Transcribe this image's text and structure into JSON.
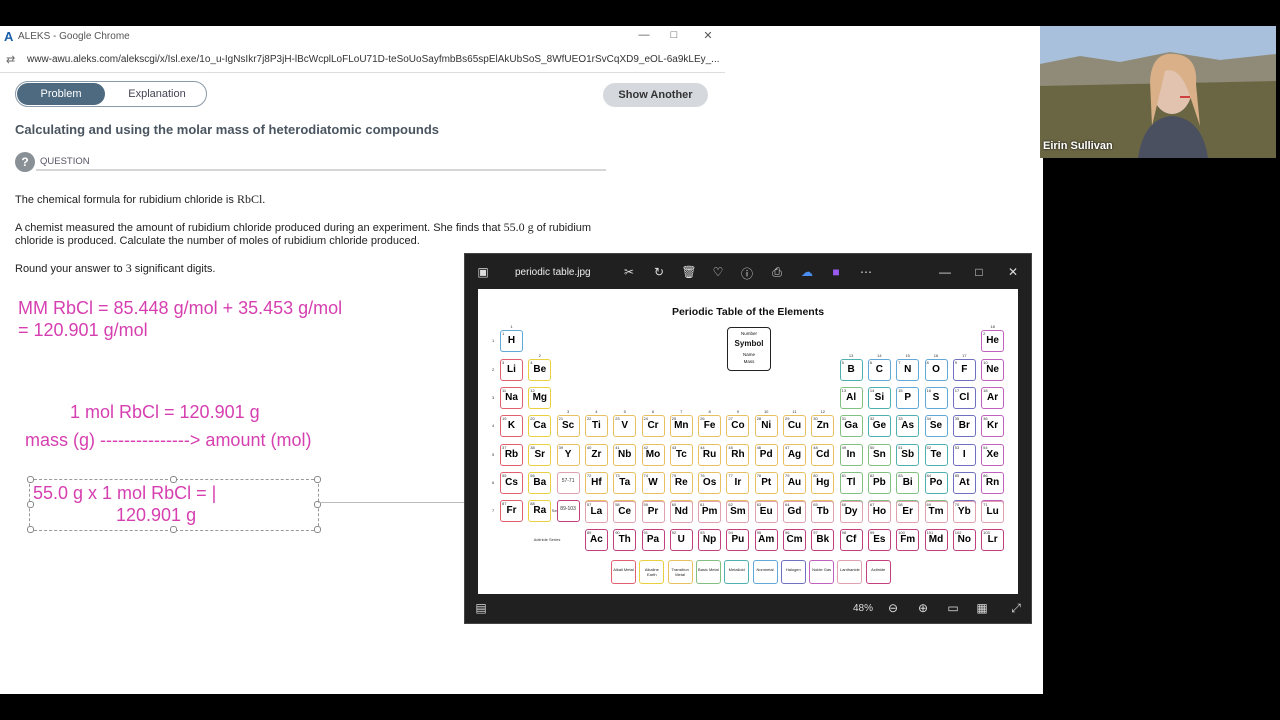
{
  "window": {
    "title": "ALEKS - Google Chrome",
    "url": "www-awu.aleks.com/alekscgi/x/Isl.exe/1o_u-IgNsIkr7j8P3jH-lBcWcplLoFLoU71D-teSoUoSayfmbBs65spElAkUbSoS_8WfUEO1rSvCqXD9_eOL-6a9kLEy_..."
  },
  "tabs": {
    "problem": "Problem",
    "explanation": "Explanation"
  },
  "show_another": "Show Another",
  "page_title": "Calculating and using the molar mass of heterodiatomic compounds",
  "question_label": "QUESTION",
  "question": {
    "line1": "The chemical formula for rubidium chloride is",
    "formula": "RbCl.",
    "p2_a": "A chemist measured the amount of rubidium chloride produced during an experiment. She finds that",
    "p2_val": "55.0 g",
    "p2_b": "of rubidium",
    "p2_line2": "chloride is produced. Calculate the number of moles of rubidium chloride produced.",
    "round_a": "Round your answer to",
    "round_val": "3",
    "round_b": "significant digits."
  },
  "notes": {
    "mm_line1": "MM RbCl = 85.448 g/mol + 35.453 g/mol",
    "mm_line2": "= 120.901 g/mol",
    "conv_line": "1 mol RbCl = 120.901 g",
    "arrow_line": "mass (g) ---------------> amount (mol)",
    "calc_line1": "55.0 g x 1 mol RbCl = |",
    "calc_line2": "120.901 g"
  },
  "webcam": {
    "name": "Eirin Sullivan"
  },
  "viewer": {
    "filename": "periodic table.jpg",
    "zoom": "48%",
    "accent": "#2d6df6",
    "icons": [
      "image-icon",
      "crop-icon",
      "rotate-icon",
      "delete-icon",
      "favorite-icon",
      "info-icon",
      "print-icon",
      "cloud-icon",
      "edit-icon",
      "more-icon"
    ]
  },
  "periodic_table": {
    "title": "Periodic Table of the Elements",
    "legend": {
      "number": "Number",
      "symbol": "Symbol",
      "name": "Name",
      "mass": "Mass"
    },
    "lanthanide_label": "Lanthanide Series",
    "actinide_label": "Actinide Series",
    "key": [
      "Alkali Metal",
      "Alkaline Earth",
      "Transition Metal",
      "Basic Metal",
      "Metalloid",
      "Nonmetal",
      "Halogen",
      "Noble Gas",
      "Lanthanide",
      "Actinide"
    ],
    "group_colors": {
      "alkali": "#e06070",
      "alkaline": "#e8d040",
      "transition": "#e8c060",
      "basic": "#80c080",
      "metalloid": "#50b0b0",
      "nonmetal": "#60a8d8",
      "halogen": "#7070c0",
      "noble": "#c060c0",
      "lanthanide": "#e0a0b0",
      "actinide": "#c04080",
      "hydrogen": "#60a8d8"
    },
    "elements": [
      [
        "1",
        "H",
        "1",
        "1",
        "hydrogen"
      ],
      [
        "2",
        "He",
        "1",
        "18",
        "noble"
      ],
      [
        "3",
        "Li",
        "2",
        "1",
        "alkali"
      ],
      [
        "4",
        "Be",
        "2",
        "2",
        "alkaline"
      ],
      [
        "5",
        "B",
        "2",
        "13",
        "metalloid"
      ],
      [
        "6",
        "C",
        "2",
        "14",
        "nonmetal"
      ],
      [
        "7",
        "N",
        "2",
        "15",
        "nonmetal"
      ],
      [
        "8",
        "O",
        "2",
        "16",
        "nonmetal"
      ],
      [
        "9",
        "F",
        "2",
        "17",
        "halogen"
      ],
      [
        "10",
        "Ne",
        "2",
        "18",
        "noble"
      ],
      [
        "11",
        "Na",
        "3",
        "1",
        "alkali"
      ],
      [
        "12",
        "Mg",
        "3",
        "2",
        "alkaline"
      ],
      [
        "13",
        "Al",
        "3",
        "13",
        "basic"
      ],
      [
        "14",
        "Si",
        "3",
        "14",
        "metalloid"
      ],
      [
        "15",
        "P",
        "3",
        "15",
        "nonmetal"
      ],
      [
        "16",
        "S",
        "3",
        "16",
        "nonmetal"
      ],
      [
        "17",
        "Cl",
        "3",
        "17",
        "halogen"
      ],
      [
        "18",
        "Ar",
        "3",
        "18",
        "noble"
      ],
      [
        "19",
        "K",
        "4",
        "1",
        "alkali"
      ],
      [
        "20",
        "Ca",
        "4",
        "2",
        "alkaline"
      ],
      [
        "21",
        "Sc",
        "4",
        "3",
        "transition"
      ],
      [
        "22",
        "Ti",
        "4",
        "4",
        "transition"
      ],
      [
        "23",
        "V",
        "4",
        "5",
        "transition"
      ],
      [
        "24",
        "Cr",
        "4",
        "6",
        "transition"
      ],
      [
        "25",
        "Mn",
        "4",
        "7",
        "transition"
      ],
      [
        "26",
        "Fe",
        "4",
        "8",
        "transition"
      ],
      [
        "27",
        "Co",
        "4",
        "9",
        "transition"
      ],
      [
        "28",
        "Ni",
        "4",
        "10",
        "transition"
      ],
      [
        "29",
        "Cu",
        "4",
        "11",
        "transition"
      ],
      [
        "30",
        "Zn",
        "4",
        "12",
        "transition"
      ],
      [
        "31",
        "Ga",
        "4",
        "13",
        "basic"
      ],
      [
        "32",
        "Ge",
        "4",
        "14",
        "metalloid"
      ],
      [
        "33",
        "As",
        "4",
        "15",
        "metalloid"
      ],
      [
        "34",
        "Se",
        "4",
        "16",
        "nonmetal"
      ],
      [
        "35",
        "Br",
        "4",
        "17",
        "halogen"
      ],
      [
        "36",
        "Kr",
        "4",
        "18",
        "noble"
      ],
      [
        "37",
        "Rb",
        "5",
        "1",
        "alkali"
      ],
      [
        "38",
        "Sr",
        "5",
        "2",
        "alkaline"
      ],
      [
        "39",
        "Y",
        "5",
        "3",
        "transition"
      ],
      [
        "40",
        "Zr",
        "5",
        "4",
        "transition"
      ],
      [
        "41",
        "Nb",
        "5",
        "5",
        "transition"
      ],
      [
        "42",
        "Mo",
        "5",
        "6",
        "transition"
      ],
      [
        "43",
        "Tc",
        "5",
        "7",
        "transition"
      ],
      [
        "44",
        "Ru",
        "5",
        "8",
        "transition"
      ],
      [
        "45",
        "Rh",
        "5",
        "9",
        "transition"
      ],
      [
        "46",
        "Pd",
        "5",
        "10",
        "transition"
      ],
      [
        "47",
        "Ag",
        "5",
        "11",
        "transition"
      ],
      [
        "48",
        "Cd",
        "5",
        "12",
        "transition"
      ],
      [
        "49",
        "In",
        "5",
        "13",
        "basic"
      ],
      [
        "50",
        "Sn",
        "5",
        "14",
        "basic"
      ],
      [
        "51",
        "Sb",
        "5",
        "15",
        "metalloid"
      ],
      [
        "52",
        "Te",
        "5",
        "16",
        "metalloid"
      ],
      [
        "53",
        "I",
        "5",
        "17",
        "halogen"
      ],
      [
        "54",
        "Xe",
        "5",
        "18",
        "noble"
      ],
      [
        "55",
        "Cs",
        "6",
        "1",
        "alkali"
      ],
      [
        "56",
        "Ba",
        "6",
        "2",
        "alkaline"
      ],
      [
        "57-71",
        "",
        "6",
        "3",
        "lanthanide"
      ],
      [
        "72",
        "Hf",
        "6",
        "4",
        "transition"
      ],
      [
        "73",
        "Ta",
        "6",
        "5",
        "transition"
      ],
      [
        "74",
        "W",
        "6",
        "6",
        "transition"
      ],
      [
        "75",
        "Re",
        "6",
        "7",
        "transition"
      ],
      [
        "76",
        "Os",
        "6",
        "8",
        "transition"
      ],
      [
        "77",
        "Ir",
        "6",
        "9",
        "transition"
      ],
      [
        "78",
        "Pt",
        "6",
        "10",
        "transition"
      ],
      [
        "79",
        "Au",
        "6",
        "11",
        "transition"
      ],
      [
        "80",
        "Hg",
        "6",
        "12",
        "transition"
      ],
      [
        "81",
        "Tl",
        "6",
        "13",
        "basic"
      ],
      [
        "82",
        "Pb",
        "6",
        "14",
        "basic"
      ],
      [
        "83",
        "Bi",
        "6",
        "15",
        "basic"
      ],
      [
        "84",
        "Po",
        "6",
        "16",
        "metalloid"
      ],
      [
        "85",
        "At",
        "6",
        "17",
        "halogen"
      ],
      [
        "86",
        "Rn",
        "6",
        "18",
        "noble"
      ],
      [
        "87",
        "Fr",
        "7",
        "1",
        "alkali"
      ],
      [
        "88",
        "Ra",
        "7",
        "2",
        "alkaline"
      ],
      [
        "89-103",
        "",
        "7",
        "3",
        "actinide"
      ],
      [
        "104",
        "Rf",
        "7",
        "4",
        "transition"
      ],
      [
        "105",
        "Db",
        "7",
        "5",
        "transition"
      ],
      [
        "106",
        "Sg",
        "7",
        "6",
        "transition"
      ],
      [
        "107",
        "Bh",
        "7",
        "7",
        "transition"
      ],
      [
        "108",
        "Hs",
        "7",
        "8",
        "transition"
      ],
      [
        "109",
        "Mt",
        "7",
        "9",
        "transition"
      ],
      [
        "110",
        "Ds",
        "7",
        "10",
        "transition"
      ],
      [
        "111",
        "Rg",
        "7",
        "11",
        "transition"
      ],
      [
        "112",
        "Cn",
        "7",
        "12",
        "transition"
      ],
      [
        "113",
        "Nh",
        "7",
        "13",
        "basic"
      ],
      [
        "114",
        "Fl",
        "7",
        "14",
        "basic"
      ],
      [
        "115",
        "Mc",
        "7",
        "15",
        "basic"
      ],
      [
        "116",
        "Lv",
        "7",
        "16",
        "basic"
      ],
      [
        "117",
        "Ts",
        "7",
        "17",
        "halogen"
      ],
      [
        "118",
        "Og",
        "7",
        "18",
        "noble"
      ]
    ],
    "lanthanides": [
      "La",
      "Ce",
      "Pr",
      "Nd",
      "Pm",
      "Sm",
      "Eu",
      "Gd",
      "Tb",
      "Dy",
      "Ho",
      "Er",
      "Tm",
      "Yb",
      "Lu"
    ],
    "lanthanide_numbers": [
      "57",
      "58",
      "59",
      "60",
      "61",
      "62",
      "63",
      "64",
      "65",
      "66",
      "67",
      "68",
      "69",
      "70",
      "71"
    ],
    "actinides": [
      "Ac",
      "Th",
      "Pa",
      "U",
      "Np",
      "Pu",
      "Am",
      "Cm",
      "Bk",
      "Cf",
      "Es",
      "Fm",
      "Md",
      "No",
      "Lr"
    ],
    "actinide_numbers": [
      "89",
      "90",
      "91",
      "92",
      "93",
      "94",
      "95",
      "96",
      "97",
      "98",
      "99",
      "100",
      "101",
      "102",
      "103"
    ]
  }
}
